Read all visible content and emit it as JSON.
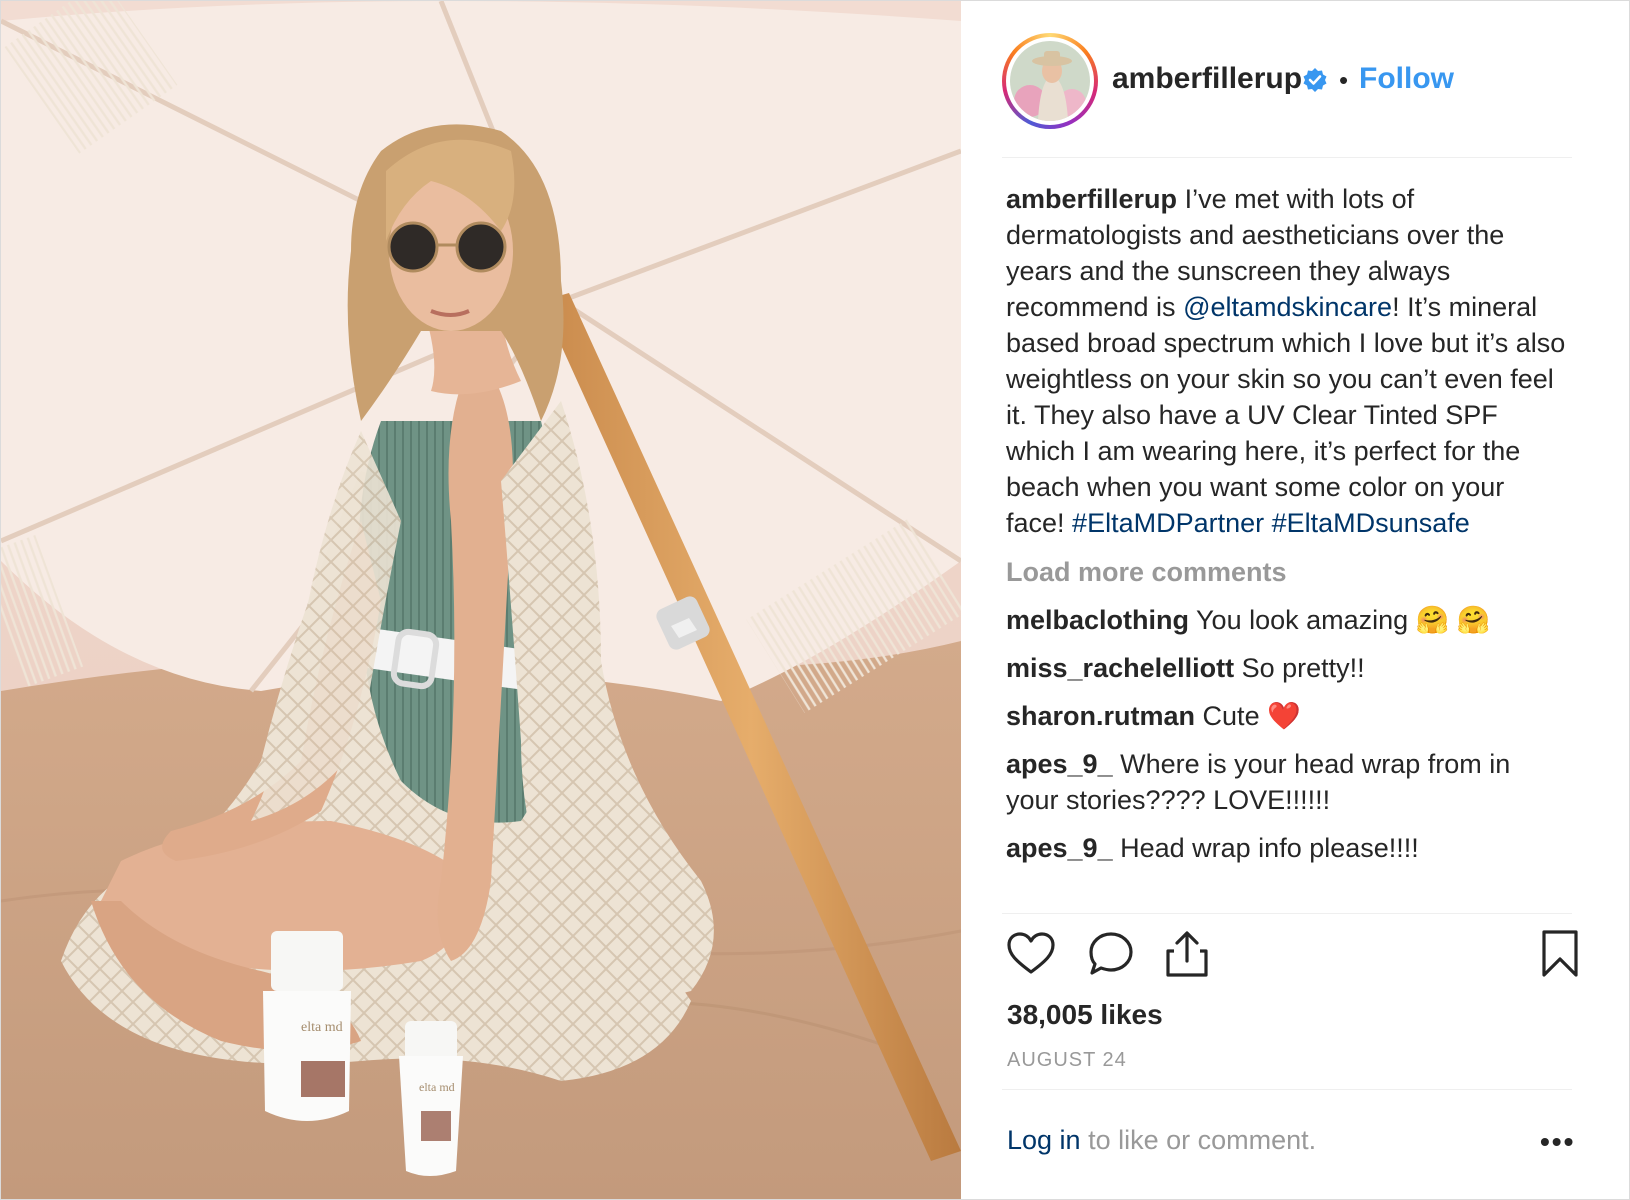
{
  "post": {
    "author": "amberfillerup",
    "follow_label": "Follow",
    "separator": "•",
    "caption": {
      "author": "amberfillerup",
      "text_1": "I’ve met with lots of dermatologists and aestheticians over the years and the sunscreen they always recommend is ",
      "mention": "@eltamdskincare",
      "text_2": "! It’s mineral based broad spectrum which I love but it’s also weightless on your skin so you can’t even feel it. They also have a UV Clear Tinted SPF which I am wearing here, it’s perfect for the beach when you want some color on your face! ",
      "hashtag_1": "#EltaMDPartner",
      "hashtag_2": "#EltaMDsunsafe"
    },
    "load_more": "Load more comments",
    "comments": [
      {
        "user": "melbaclothing",
        "text": "You look amazing 🤗 🤗"
      },
      {
        "user": "miss_rachelelliott",
        "text": "So pretty!!"
      },
      {
        "user": "sharon.rutman",
        "text": "Cute ❤️"
      },
      {
        "user": "apes_9_",
        "text": "Where is your head wrap from in your stories???? LOVE!!!!!!"
      },
      {
        "user": "apes_9_",
        "text": "Head wrap info please!!!!"
      }
    ],
    "likes": "38,005 likes",
    "date": "AUGUST 24",
    "footer": {
      "login": "Log in",
      "rest": " to like or comment.",
      "more": "•••"
    },
    "product_label": "elta md"
  },
  "colors": {
    "link": "#003569",
    "follow": "#3897f0",
    "muted": "#999999",
    "verified": "#3897f0"
  }
}
